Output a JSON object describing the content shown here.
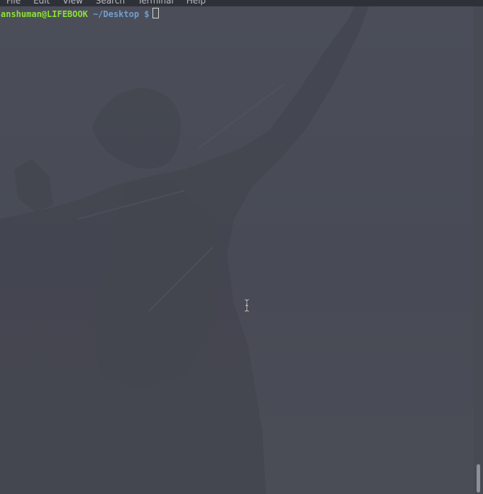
{
  "menubar": {
    "items": [
      {
        "label": "File"
      },
      {
        "label": "Edit"
      },
      {
        "label": "View"
      },
      {
        "label": "Search"
      },
      {
        "label": "Terminal"
      },
      {
        "label": "Help"
      }
    ]
  },
  "terminal": {
    "prompt_user_host": "anshuman@LIFEBOOK",
    "prompt_path": "~/Desktop $",
    "command": ""
  },
  "colors": {
    "background": "#4a4d57",
    "prompt_user": "#8ae234",
    "prompt_path": "#729fcf",
    "scroll_thumb": "#8d9098"
  },
  "icons": {
    "mouse_cursor": "ibeam-cursor-icon"
  }
}
